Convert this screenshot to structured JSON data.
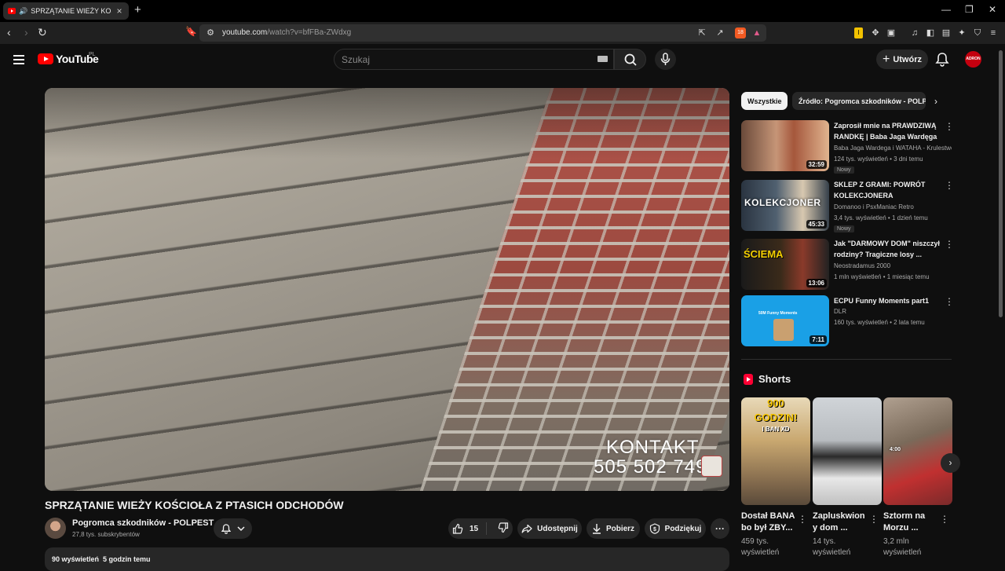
{
  "browser": {
    "tab_title": "SPRZĄTANIE WIEŻY KOŚCIOŁ",
    "tab_audio": "🔊",
    "tab_close": "×",
    "new_tab": "+",
    "url_main": "youtube.com",
    "url_rest": "/watch?v=bfFBa-ZWdxg",
    "ext_badge": "18"
  },
  "header": {
    "logo_text": "YouTube",
    "country": "PL",
    "search_placeholder": "Szukaj",
    "create_plus": "+",
    "create_label": "Utwórz",
    "account_initials": "ADRON"
  },
  "video": {
    "overlay_line1": "KONTAKT",
    "overlay_line2": "505 502 749",
    "title": "SPRZĄTANIE WIEŻY KOŚCIOŁA Z PTASICH ODCHODÓW",
    "channel_name": "Pogromca szkodników - POLPEST",
    "subscribers": "27,8 tys. subskrybentów",
    "likes": "15",
    "share_label": "Udostępnij",
    "download_label": "Pobierz",
    "thanks_label": "Podziękuj",
    "more": "···",
    "views": "90 wyświetleń",
    "posted": "5 godzin temu"
  },
  "chips": {
    "all": "Wszystkie",
    "source": "Źródło: Pogromca szkodników - POLPEST"
  },
  "recommendations": [
    {
      "title": "Zaprosił mnie na PRAWDZIWĄ RANDKĘ | Baba Jaga Wardęga",
      "channel": "Baba Jaga Wardega i WATAHA - Krulestwo",
      "views": "124 tys. wyświetleń",
      "age": "3 dni temu",
      "badge": "Nowy",
      "duration": "32:59"
    },
    {
      "title": "SKLEP Z GRAMI: POWRÓT KOLEKCJONERA",
      "channel": "Domanoo i PsxManiac Retro",
      "views": "3,4 tys. wyświetleń",
      "age": "1 dzień temu",
      "badge": "Nowy",
      "duration": "45:33",
      "thumb_text": "KOLEKCJONER"
    },
    {
      "title": "Jak \"DARMOWY DOM\" niszczył rodziny? Tragiczne losy ...",
      "channel": "Neostradamus 2000",
      "views": "1 mln wyświetleń",
      "age": "1 miesiąc temu",
      "badge": "",
      "duration": "13:06",
      "thumb_text": "ŚCIEMA"
    },
    {
      "title": "ECPU Funny Moments part1",
      "channel": "DLR",
      "views": "160 tys. wyświetleń",
      "age": "2 lata temu",
      "badge": "",
      "duration": "7:11",
      "thumb_text": "50M Funny Moments"
    }
  ],
  "shorts": {
    "heading": "Shorts",
    "items": [
      {
        "title": "Dostał BANA bo był ZBY...",
        "views": "459 tys. wyświetleń",
        "thumb_line1": "900",
        "thumb_line2": "GODZIN!",
        "thumb_line3": "I BAN XD"
      },
      {
        "title": "Zapluskwion y dom ...",
        "views": "14 tys. wyświetleń"
      },
      {
        "title": "Sztorm na Morzu ...",
        "views": "3,2 mln wyświetleń",
        "thumb_line1": "4:00"
      }
    ]
  },
  "colors": {
    "background": "#0f0f0f",
    "surface": "#272727",
    "brand_red": "#ff0000",
    "text": "#f1f1f1",
    "secondary_text": "#aaaaaa"
  }
}
